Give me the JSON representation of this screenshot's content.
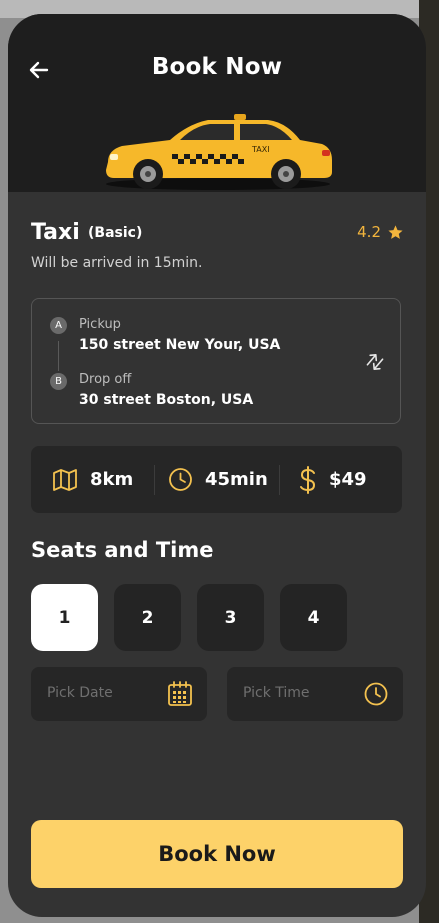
{
  "header": {
    "title": "Book Now"
  },
  "vehicle": {
    "name": "Taxi",
    "tier": "(Basic)",
    "rating": "4.2",
    "arrival": "Will be arrived in 15min.",
    "car_sign": "TAXI"
  },
  "route": {
    "pickup": {
      "badge": "A",
      "label": "Pickup",
      "address": "150 street New Your, USA"
    },
    "dropoff": {
      "badge": "B",
      "label": "Drop off",
      "address": "30 street Boston, USA"
    }
  },
  "stats": {
    "distance": "8km",
    "duration": "45min",
    "price": "$49"
  },
  "seats": {
    "title": "Seats and Time",
    "options": [
      "1",
      "2",
      "3",
      "4"
    ],
    "selected": "1"
  },
  "pickers": {
    "date_placeholder": "Pick Date",
    "time_placeholder": "Pick Time"
  },
  "cta": {
    "label": "Book Now"
  },
  "colors": {
    "accent": "#fdd269",
    "rating": "#f3b53d",
    "icon": "#f3c14f",
    "surface": "#333333",
    "header": "#1e1e1e"
  },
  "icons": [
    "back-arrow-icon",
    "star-icon",
    "swap-icon",
    "map-icon",
    "clock-icon",
    "dollar-icon",
    "calendar-icon"
  ]
}
